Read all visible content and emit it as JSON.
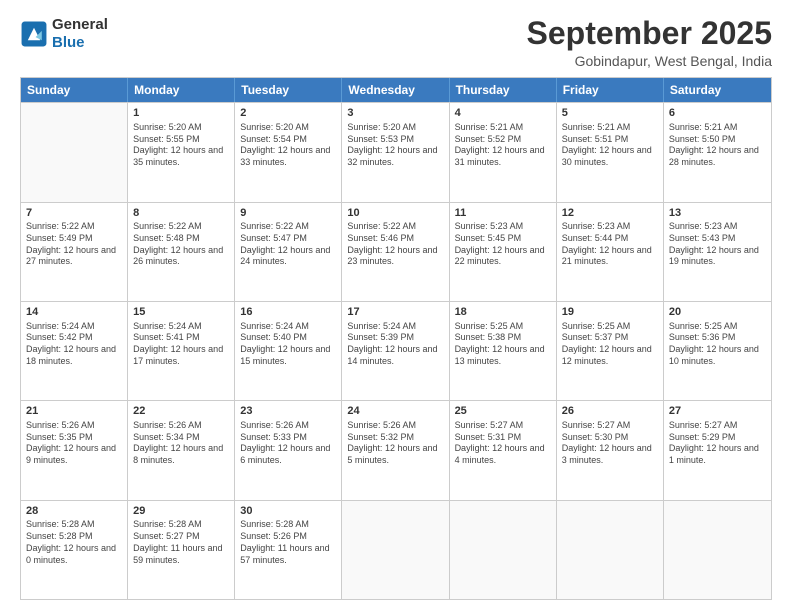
{
  "logo": {
    "line1": "General",
    "line2": "Blue"
  },
  "title": "September 2025",
  "location": "Gobindapur, West Bengal, India",
  "headers": [
    "Sunday",
    "Monday",
    "Tuesday",
    "Wednesday",
    "Thursday",
    "Friday",
    "Saturday"
  ],
  "rows": [
    [
      {
        "day": "",
        "empty": true,
        "sunrise": "",
        "sunset": "",
        "daylight": ""
      },
      {
        "day": "1",
        "sunrise": "Sunrise: 5:20 AM",
        "sunset": "Sunset: 5:55 PM",
        "daylight": "Daylight: 12 hours and 35 minutes."
      },
      {
        "day": "2",
        "sunrise": "Sunrise: 5:20 AM",
        "sunset": "Sunset: 5:54 PM",
        "daylight": "Daylight: 12 hours and 33 minutes."
      },
      {
        "day": "3",
        "sunrise": "Sunrise: 5:20 AM",
        "sunset": "Sunset: 5:53 PM",
        "daylight": "Daylight: 12 hours and 32 minutes."
      },
      {
        "day": "4",
        "sunrise": "Sunrise: 5:21 AM",
        "sunset": "Sunset: 5:52 PM",
        "daylight": "Daylight: 12 hours and 31 minutes."
      },
      {
        "day": "5",
        "sunrise": "Sunrise: 5:21 AM",
        "sunset": "Sunset: 5:51 PM",
        "daylight": "Daylight: 12 hours and 30 minutes."
      },
      {
        "day": "6",
        "sunrise": "Sunrise: 5:21 AM",
        "sunset": "Sunset: 5:50 PM",
        "daylight": "Daylight: 12 hours and 28 minutes."
      }
    ],
    [
      {
        "day": "7",
        "sunrise": "Sunrise: 5:22 AM",
        "sunset": "Sunset: 5:49 PM",
        "daylight": "Daylight: 12 hours and 27 minutes."
      },
      {
        "day": "8",
        "sunrise": "Sunrise: 5:22 AM",
        "sunset": "Sunset: 5:48 PM",
        "daylight": "Daylight: 12 hours and 26 minutes."
      },
      {
        "day": "9",
        "sunrise": "Sunrise: 5:22 AM",
        "sunset": "Sunset: 5:47 PM",
        "daylight": "Daylight: 12 hours and 24 minutes."
      },
      {
        "day": "10",
        "sunrise": "Sunrise: 5:22 AM",
        "sunset": "Sunset: 5:46 PM",
        "daylight": "Daylight: 12 hours and 23 minutes."
      },
      {
        "day": "11",
        "sunrise": "Sunrise: 5:23 AM",
        "sunset": "Sunset: 5:45 PM",
        "daylight": "Daylight: 12 hours and 22 minutes."
      },
      {
        "day": "12",
        "sunrise": "Sunrise: 5:23 AM",
        "sunset": "Sunset: 5:44 PM",
        "daylight": "Daylight: 12 hours and 21 minutes."
      },
      {
        "day": "13",
        "sunrise": "Sunrise: 5:23 AM",
        "sunset": "Sunset: 5:43 PM",
        "daylight": "Daylight: 12 hours and 19 minutes."
      }
    ],
    [
      {
        "day": "14",
        "sunrise": "Sunrise: 5:24 AM",
        "sunset": "Sunset: 5:42 PM",
        "daylight": "Daylight: 12 hours and 18 minutes."
      },
      {
        "day": "15",
        "sunrise": "Sunrise: 5:24 AM",
        "sunset": "Sunset: 5:41 PM",
        "daylight": "Daylight: 12 hours and 17 minutes."
      },
      {
        "day": "16",
        "sunrise": "Sunrise: 5:24 AM",
        "sunset": "Sunset: 5:40 PM",
        "daylight": "Daylight: 12 hours and 15 minutes."
      },
      {
        "day": "17",
        "sunrise": "Sunrise: 5:24 AM",
        "sunset": "Sunset: 5:39 PM",
        "daylight": "Daylight: 12 hours and 14 minutes."
      },
      {
        "day": "18",
        "sunrise": "Sunrise: 5:25 AM",
        "sunset": "Sunset: 5:38 PM",
        "daylight": "Daylight: 12 hours and 13 minutes."
      },
      {
        "day": "19",
        "sunrise": "Sunrise: 5:25 AM",
        "sunset": "Sunset: 5:37 PM",
        "daylight": "Daylight: 12 hours and 12 minutes."
      },
      {
        "day": "20",
        "sunrise": "Sunrise: 5:25 AM",
        "sunset": "Sunset: 5:36 PM",
        "daylight": "Daylight: 12 hours and 10 minutes."
      }
    ],
    [
      {
        "day": "21",
        "sunrise": "Sunrise: 5:26 AM",
        "sunset": "Sunset: 5:35 PM",
        "daylight": "Daylight: 12 hours and 9 minutes."
      },
      {
        "day": "22",
        "sunrise": "Sunrise: 5:26 AM",
        "sunset": "Sunset: 5:34 PM",
        "daylight": "Daylight: 12 hours and 8 minutes."
      },
      {
        "day": "23",
        "sunrise": "Sunrise: 5:26 AM",
        "sunset": "Sunset: 5:33 PM",
        "daylight": "Daylight: 12 hours and 6 minutes."
      },
      {
        "day": "24",
        "sunrise": "Sunrise: 5:26 AM",
        "sunset": "Sunset: 5:32 PM",
        "daylight": "Daylight: 12 hours and 5 minutes."
      },
      {
        "day": "25",
        "sunrise": "Sunrise: 5:27 AM",
        "sunset": "Sunset: 5:31 PM",
        "daylight": "Daylight: 12 hours and 4 minutes."
      },
      {
        "day": "26",
        "sunrise": "Sunrise: 5:27 AM",
        "sunset": "Sunset: 5:30 PM",
        "daylight": "Daylight: 12 hours and 3 minutes."
      },
      {
        "day": "27",
        "sunrise": "Sunrise: 5:27 AM",
        "sunset": "Sunset: 5:29 PM",
        "daylight": "Daylight: 12 hours and 1 minute."
      }
    ],
    [
      {
        "day": "28",
        "sunrise": "Sunrise: 5:28 AM",
        "sunset": "Sunset: 5:28 PM",
        "daylight": "Daylight: 12 hours and 0 minutes."
      },
      {
        "day": "29",
        "sunrise": "Sunrise: 5:28 AM",
        "sunset": "Sunset: 5:27 PM",
        "daylight": "Daylight: 11 hours and 59 minutes."
      },
      {
        "day": "30",
        "sunrise": "Sunrise: 5:28 AM",
        "sunset": "Sunset: 5:26 PM",
        "daylight": "Daylight: 11 hours and 57 minutes."
      },
      {
        "day": "",
        "empty": true,
        "sunrise": "",
        "sunset": "",
        "daylight": ""
      },
      {
        "day": "",
        "empty": true,
        "sunrise": "",
        "sunset": "",
        "daylight": ""
      },
      {
        "day": "",
        "empty": true,
        "sunrise": "",
        "sunset": "",
        "daylight": ""
      },
      {
        "day": "",
        "empty": true,
        "sunrise": "",
        "sunset": "",
        "daylight": ""
      }
    ]
  ]
}
